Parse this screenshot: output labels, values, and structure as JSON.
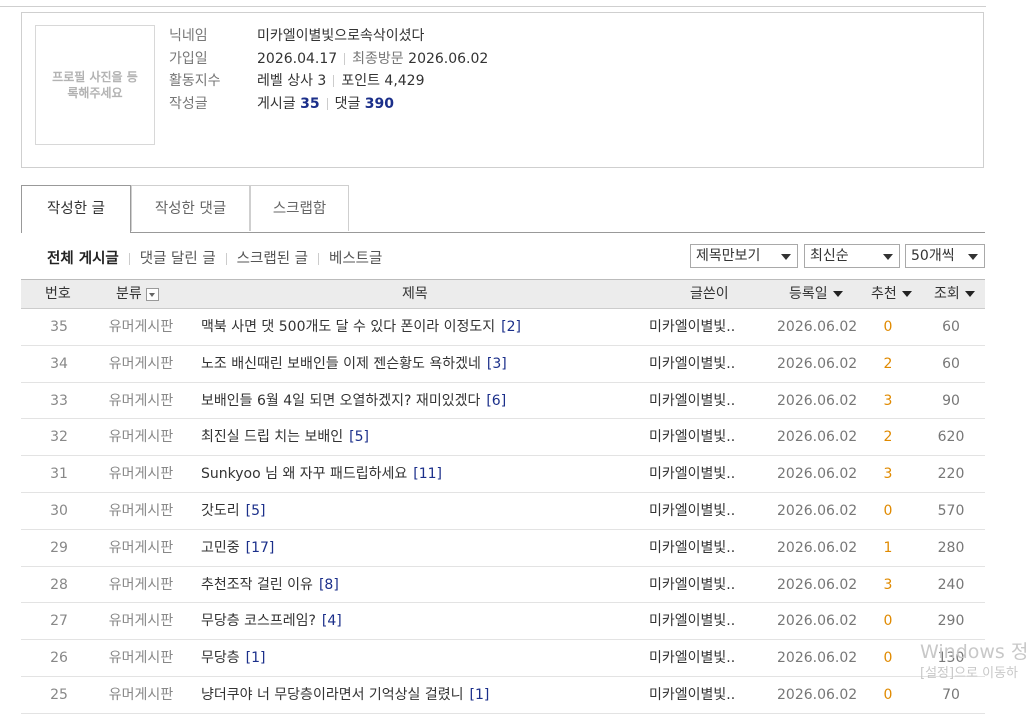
{
  "profile": {
    "photo_placeholder": "프로필 사진을 등록해주세요",
    "nickname_label": "닉네임",
    "nickname": "미카엘이별빛으로속삭이셨다",
    "joined_label": "가입일",
    "joined": "2026.04.17",
    "last_visit_label": "최종방문",
    "last_visit": "2026.06.02",
    "activity_label": "활동지수",
    "level": "레벨 상사 3",
    "points_label": "포인트",
    "points": "4,429",
    "written_label": "작성글",
    "posts_label": "게시글",
    "posts": "35",
    "comments_label": "댓글",
    "comments": "390"
  },
  "tabs": [
    "작성한 글",
    "작성한 댓글",
    "스크랩함"
  ],
  "subnav": [
    "전체 게시글",
    "댓글 달린 글",
    "스크랩된 글",
    "베스트글"
  ],
  "filters": {
    "view": "제목만보기",
    "sort": "최신순",
    "count": "50개씩"
  },
  "columns": {
    "no": "번호",
    "category": "분류",
    "title": "제목",
    "author": "글쓴이",
    "date": "등록일",
    "recommend": "추천",
    "views": "조회"
  },
  "rows": [
    {
      "no": "35",
      "cat": "유머게시판",
      "title": "맥북 사면 댓 500개도 달 수 있다 폰이라 이정도지",
      "cm": "[2]",
      "author": "미카엘이별빛..",
      "date": "2026.06.02",
      "rec": "0",
      "views": "60"
    },
    {
      "no": "34",
      "cat": "유머게시판",
      "title": "노조 배신때린 보배인들 이제 젠슨황도 욕하겠네",
      "cm": "[3]",
      "author": "미카엘이별빛..",
      "date": "2026.06.02",
      "rec": "2",
      "views": "60"
    },
    {
      "no": "33",
      "cat": "유머게시판",
      "title": "보배인들 6월 4일 되면 오열하겠지? 재미있겠다",
      "cm": "[6]",
      "author": "미카엘이별빛..",
      "date": "2026.06.02",
      "rec": "3",
      "views": "90"
    },
    {
      "no": "32",
      "cat": "유머게시판",
      "title": "최진실 드립 치는 보배인",
      "cm": "[5]",
      "author": "미카엘이별빛..",
      "date": "2026.06.02",
      "rec": "2",
      "views": "620"
    },
    {
      "no": "31",
      "cat": "유머게시판",
      "title": "Sunkyoo 님 왜 자꾸 패드립하세요",
      "cm": "[11]",
      "author": "미카엘이별빛..",
      "date": "2026.06.02",
      "rec": "3",
      "views": "220"
    },
    {
      "no": "30",
      "cat": "유머게시판",
      "title": "갓도리",
      "cm": "[5]",
      "author": "미카엘이별빛..",
      "date": "2026.06.02",
      "rec": "0",
      "views": "570"
    },
    {
      "no": "29",
      "cat": "유머게시판",
      "title": "고민중",
      "cm": "[17]",
      "author": "미카엘이별빛..",
      "date": "2026.06.02",
      "rec": "1",
      "views": "280"
    },
    {
      "no": "28",
      "cat": "유머게시판",
      "title": "추천조작 걸린 이유",
      "cm": "[8]",
      "author": "미카엘이별빛..",
      "date": "2026.06.02",
      "rec": "3",
      "views": "240"
    },
    {
      "no": "27",
      "cat": "유머게시판",
      "title": "무당층 코스프레임?",
      "cm": "[4]",
      "author": "미카엘이별빛..",
      "date": "2026.06.02",
      "rec": "0",
      "views": "290"
    },
    {
      "no": "26",
      "cat": "유머게시판",
      "title": "무당층",
      "cm": "[1]",
      "author": "미카엘이별빛..",
      "date": "2026.06.02",
      "rec": "0",
      "views": "130"
    },
    {
      "no": "25",
      "cat": "유머게시판",
      "title": "냥더쿠야 너 무당층이라면서 기억상실 걸렸니",
      "cm": "[1]",
      "author": "미카엘이별빛..",
      "date": "2026.06.02",
      "rec": "0",
      "views": "70"
    }
  ],
  "watermark": {
    "line1": "Windows 정",
    "line2": "[설정]으로 이동하"
  }
}
